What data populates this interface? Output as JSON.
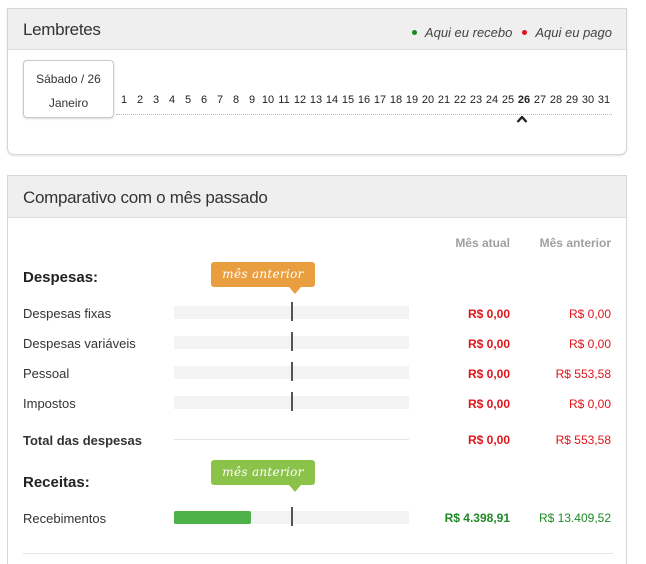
{
  "reminders": {
    "title": "Lembretes",
    "legend": {
      "receive_label": "Aqui eu recebo",
      "receive_color": "#1a8a1a",
      "pay_label": "Aqui eu pago",
      "pay_color": "#e0141a"
    },
    "selected_date": {
      "weekday_day": "Sábado / 26",
      "month": "Janeiro"
    },
    "days": [
      "1",
      "2",
      "3",
      "4",
      "5",
      "6",
      "7",
      "8",
      "9",
      "10",
      "11",
      "12",
      "13",
      "14",
      "15",
      "16",
      "17",
      "18",
      "19",
      "20",
      "21",
      "22",
      "23",
      "24",
      "25",
      "26",
      "27",
      "28",
      "29",
      "30",
      "31"
    ],
    "current_day": "26",
    "caret_icon": "chevron-up-icon"
  },
  "comparison": {
    "title": "Comparativo com o mês passado",
    "col_current": "Mês atual",
    "col_previous": "Mês anterior",
    "badge_label": "mês anterior",
    "expenses": {
      "title": "Despesas:",
      "rows": [
        {
          "label": "Despesas fixas",
          "current": "R$ 0,00",
          "previous": "R$ 0,00",
          "fill": 0
        },
        {
          "label": "Despesas variáveis",
          "current": "R$ 0,00",
          "previous": "R$ 0,00",
          "fill": 0
        },
        {
          "label": "Pessoal",
          "current": "R$ 0,00",
          "previous": "R$ 553,58",
          "fill": 0
        },
        {
          "label": "Impostos",
          "current": "R$ 0,00",
          "previous": "R$ 0,00",
          "fill": 0
        }
      ],
      "total": {
        "label": "Total das despesas",
        "current": "R$ 0,00",
        "previous": "R$ 553,58"
      }
    },
    "income": {
      "title": "Receitas:",
      "rows": [
        {
          "label": "Recebimentos",
          "current": "R$ 4.398,91",
          "previous": "R$ 13.409,52",
          "fill": 0.328
        }
      ]
    }
  }
}
